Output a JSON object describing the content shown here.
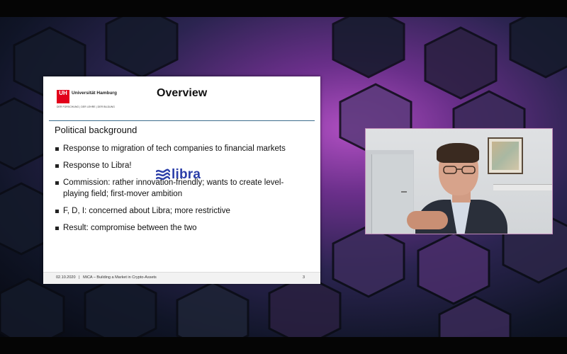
{
  "slide": {
    "logo": {
      "mark": "UH",
      "name": "Universität Hamburg",
      "tagline": "DER FORSCHUNG | DER LEHRE | DER BILDUNG"
    },
    "title": "Overview",
    "subheading": "Political background",
    "bullets": [
      "Response to migration of tech companies to financial markets",
      "Response to Libra!",
      "Commission: rather innovation-friendly; wants to create level-playing field; first-mover ambition",
      "F, D, I: concerned about Libra; more restrictive",
      "Result: compromise between the two"
    ],
    "libra_logo_text": "libra",
    "footer": {
      "date": "02.10.2020",
      "separator": "|",
      "title": "MiCA – Building a Market in Crypto-Assets",
      "page": "3"
    }
  },
  "colors": {
    "uhh_red": "#e2001a",
    "header_rule": "#3d6e8c",
    "libra_blue": "#2b3ea8",
    "video_border": "#c08ab8"
  },
  "icons": [
    "libra-logo-icon",
    "university-logo"
  ]
}
